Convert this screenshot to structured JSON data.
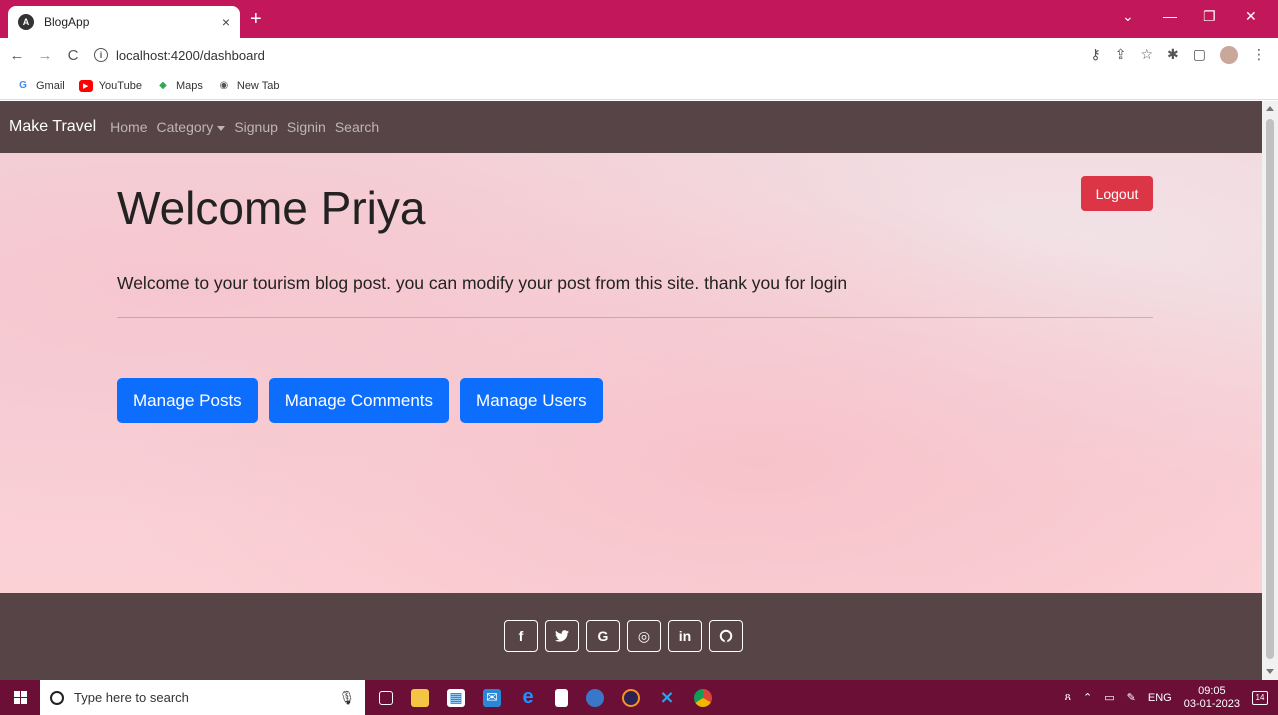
{
  "browser": {
    "tab_title": "BlogApp",
    "favicon_letter": "A",
    "tab_close": "×",
    "new_tab": "+",
    "url": "localhost:4200/dashboard",
    "bookmarks": [
      {
        "icon": "G",
        "label": "Gmail",
        "color": "#4285f4"
      },
      {
        "icon": "▶",
        "label": "YouTube",
        "color": "#ff0000"
      },
      {
        "icon": "◆",
        "label": "Maps",
        "color": "#34a853"
      },
      {
        "icon": "◉",
        "label": "New Tab",
        "color": "#555555"
      }
    ]
  },
  "navbar": {
    "brand": "Make Travel",
    "links": [
      "Home",
      "Category",
      "Signup",
      "Signin",
      "Search"
    ]
  },
  "main": {
    "title": "Welcome Priya",
    "logout_label": "Logout",
    "lead": "Welcome to your tourism blog post. you can modify your post from this site. thank you for login",
    "buttons": [
      "Manage Posts",
      "Manage Comments",
      "Manage Users"
    ]
  },
  "footer": {
    "social": [
      {
        "name": "facebook-icon",
        "glyph": "f"
      },
      {
        "name": "twitter-icon",
        "glyph": "🐦"
      },
      {
        "name": "google-icon",
        "glyph": "G"
      },
      {
        "name": "instagram-icon",
        "glyph": "◎"
      },
      {
        "name": "linkedin-icon",
        "glyph": "in"
      },
      {
        "name": "github-icon",
        "glyph": "○"
      }
    ]
  },
  "taskbar": {
    "search_placeholder": "Type here to search",
    "lang": "ENG",
    "time": "09:05",
    "date": "03-01-2023",
    "notifications": "14"
  },
  "colors": {
    "navbar_bg": "#574446",
    "logout": "#dc3545",
    "primary": "#0d6efd",
    "tabbar": "#c2185b",
    "taskbar": "#6b0f37"
  }
}
